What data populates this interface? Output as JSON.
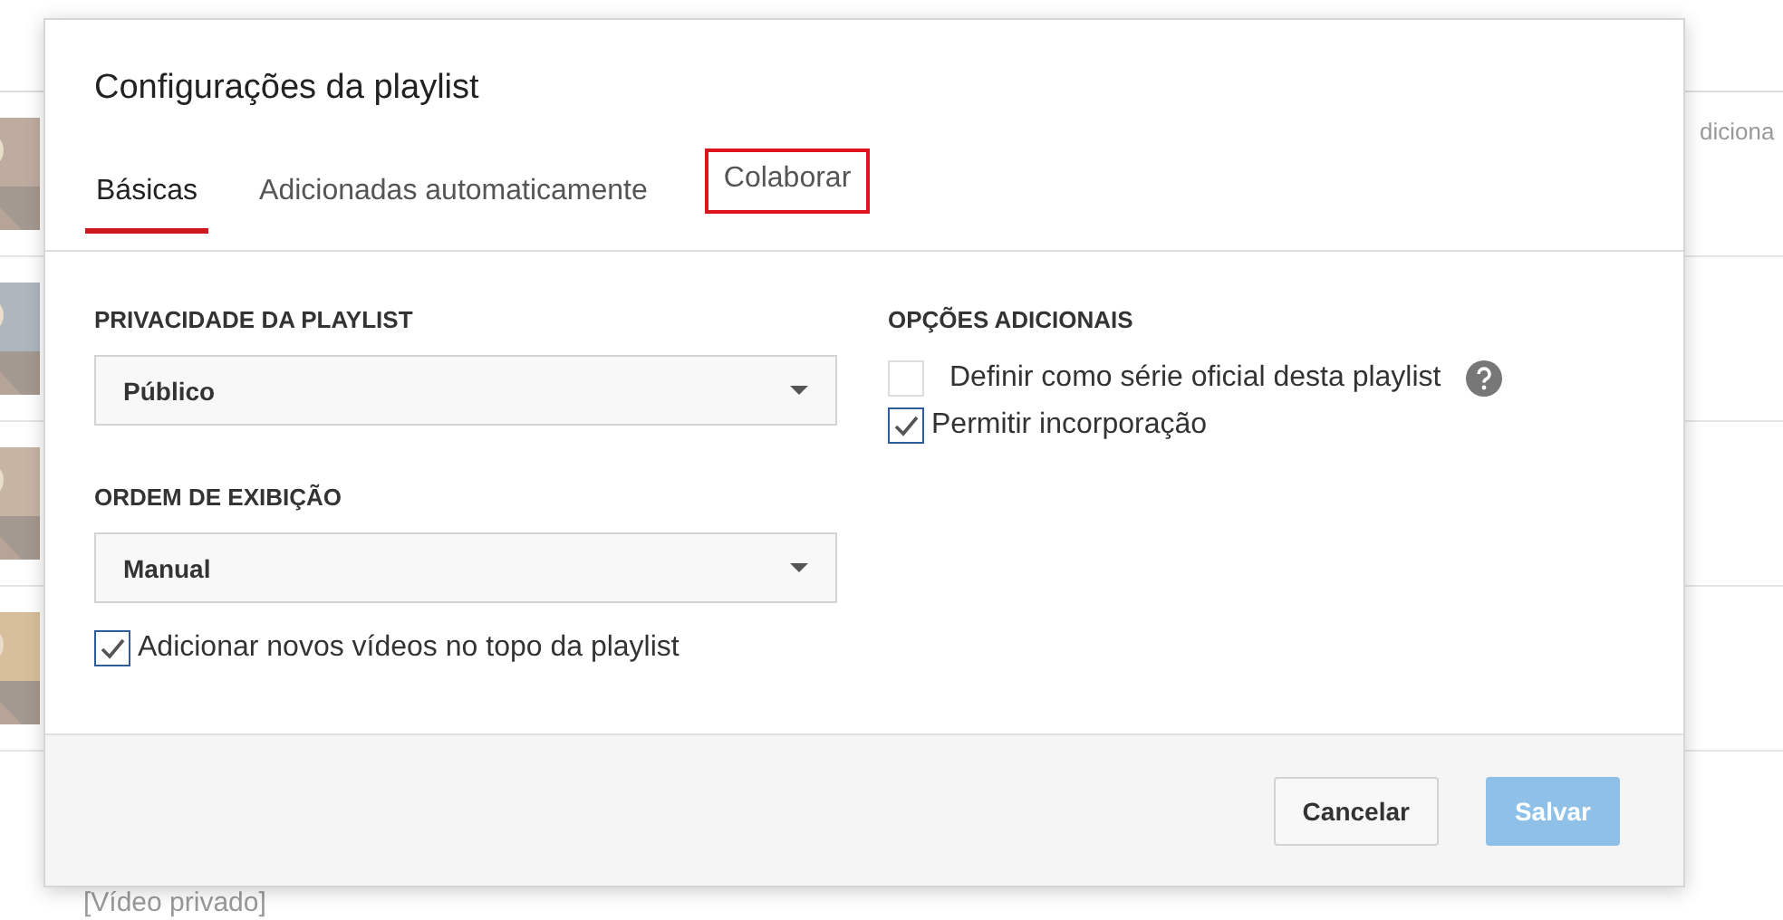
{
  "background": {
    "header_text": "diciona",
    "footer_text": "[Vídeo privado]"
  },
  "dialog": {
    "title": "Configurações da playlist",
    "tabs": [
      {
        "label": "Básicas",
        "selected": true,
        "highlighted": false
      },
      {
        "label": "Adicionadas automaticamente",
        "selected": false,
        "highlighted": false
      },
      {
        "label": "Colaborar",
        "selected": false,
        "highlighted": true
      }
    ],
    "left_sections": [
      {
        "label": "PRIVACIDADE DA PLAYLIST",
        "value": "Público"
      },
      {
        "label": "ORDEM DE EXIBIÇÃO",
        "value": "Manual"
      }
    ],
    "left_options": [
      {
        "label": "Adicionar novos vídeos no topo da playlist",
        "checked": true,
        "help": false
      }
    ],
    "right_section": {
      "label": "OPÇÕES ADICIONAIS",
      "options": [
        {
          "label": "Definir como série oficial desta playlist",
          "checked": false,
          "help": true
        },
        {
          "label": "Permitir incorporação",
          "checked": true,
          "help": false
        }
      ]
    },
    "buttons": [
      {
        "label": "Cancelar",
        "kind": "secondary",
        "disabled": false
      },
      {
        "label": "Salvar",
        "kind": "primary",
        "disabled": true
      }
    ]
  }
}
